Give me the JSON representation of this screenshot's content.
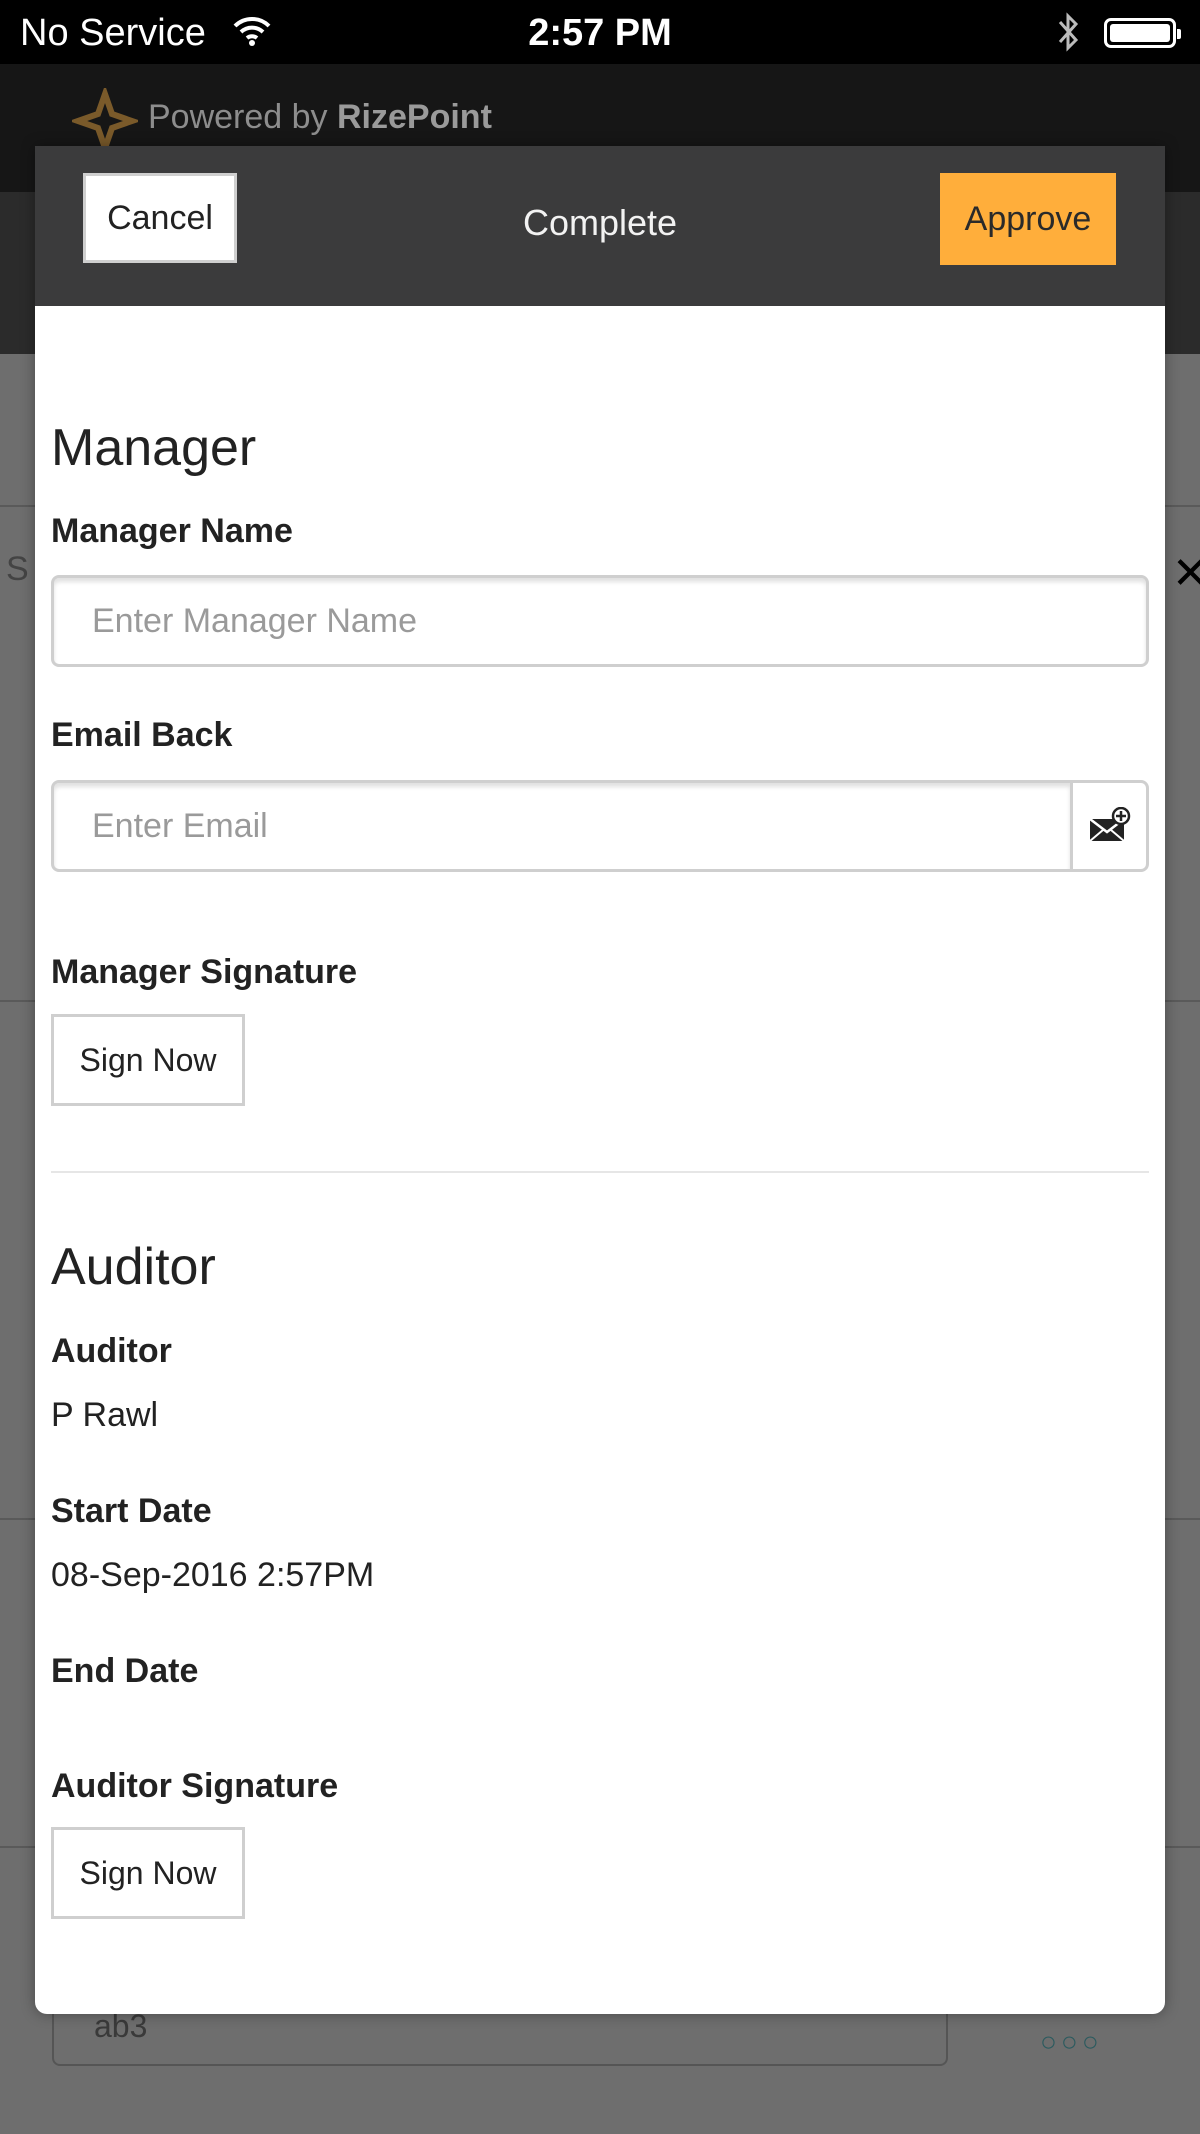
{
  "status_bar": {
    "carrier": "No Service",
    "time": "2:57 PM"
  },
  "background_app": {
    "powered_by_prefix": "Powered by ",
    "brand": "RizePoint",
    "partial_letter": "S",
    "field_value": "ab3"
  },
  "modal": {
    "cancel_label": "Cancel",
    "title": "Complete",
    "approve_label": "Approve",
    "manager": {
      "section_title": "Manager",
      "name_label": "Manager Name",
      "name_placeholder": "Enter Manager Name",
      "email_label": "Email Back",
      "email_placeholder": "Enter Email",
      "signature_label": "Manager Signature",
      "sign_label": "Sign Now"
    },
    "auditor": {
      "section_title": "Auditor",
      "auditor_label": "Auditor",
      "auditor_value": "P Rawl",
      "start_date_label": "Start Date",
      "start_date_value": "08-Sep-2016 2:57PM",
      "end_date_label": "End Date",
      "signature_label": "Auditor Signature",
      "sign_label": "Sign Now"
    }
  },
  "icons": {
    "wifi": "wifi-icon",
    "bluetooth": "bluetooth-icon",
    "battery": "battery-icon",
    "logo": "rizepoint-logo-icon",
    "email_add": "email-add-icon",
    "close": "close-icon",
    "more": "more-dots-icon"
  },
  "colors": {
    "approve": "#ffae3b",
    "modal_header": "#3b3b3c",
    "status_bar": "#000000"
  }
}
